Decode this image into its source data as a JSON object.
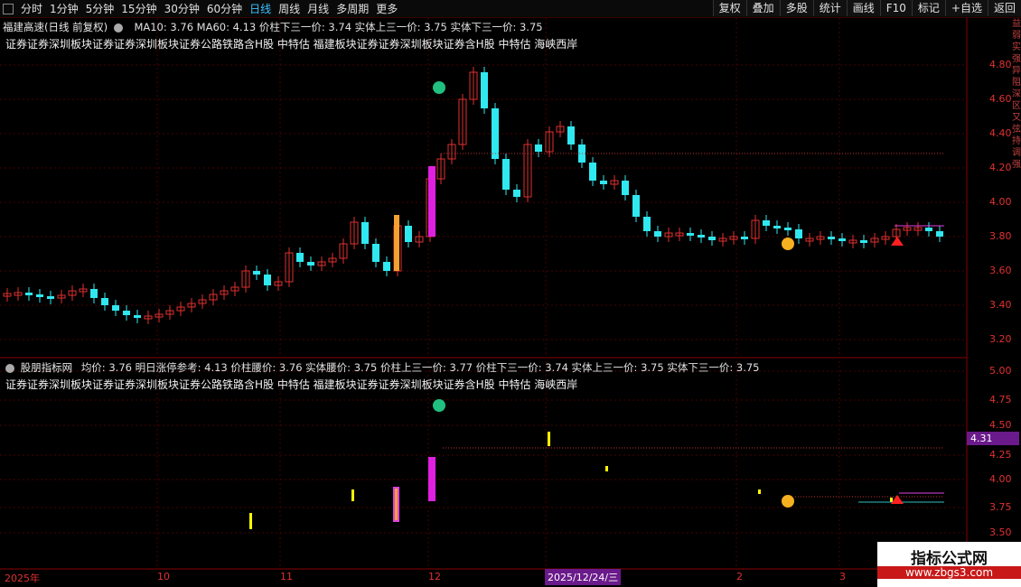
{
  "toolbar": {
    "left_items": [
      "分时",
      "1分钟",
      "5分钟",
      "15分钟",
      "30分钟",
      "60分钟",
      "日线",
      "周线",
      "月线",
      "多周期",
      "更多"
    ],
    "active_index": 6,
    "right_buttons": [
      "复权",
      "叠加",
      "多股",
      "统计",
      "画线",
      "F10",
      "标记",
      "+自选",
      "返回"
    ]
  },
  "main": {
    "title": "福建高速(日线 前复权)",
    "indicators": "MA10: 3.76  MA60: 4.13  价柱下三一价: 3.74  实体上三一价: 3.75  实体下三一价: 3.75",
    "sectors": "证券证券深圳板块证券证券深圳板块证券公路铁路含H股 中特估 福建板块证券证券深圳板块证券含H股 中特估 海峡西岸",
    "y_labels": [
      "4.80",
      "4.60",
      "4.40",
      "4.20",
      "4.00",
      "3.80",
      "3.60",
      "3.40",
      "3.20"
    ]
  },
  "sub": {
    "title": "股朋指标网",
    "indicators": "均价: 3.76  明日涨停参考: 4.13  价柱腰价: 3.76  实体腰价: 3.75  价柱上三一价: 3.77  价柱下三一价: 3.74  实体上三一价: 3.75  实体下三一价: 3.75",
    "sectors": "证券证券深圳板块证券证券深圳板块证券公路铁路含H股 中特估 福建板块证券证券深圳板块证券含H股 中特估 海峡西岸",
    "y_labels": [
      "5.00",
      "4.75",
      "4.50",
      "4.25",
      "4.00",
      "3.75",
      "3.50"
    ],
    "price_tag": "4.31"
  },
  "x_axis": {
    "labels": [
      "2025年",
      "10",
      "11",
      "12",
      "2",
      "3"
    ],
    "current_date": "2025/12/24/三"
  },
  "watermark": {
    "title": "指标公式网",
    "url": "www.zbgs3.com"
  },
  "right_strip": "益弱实强异阻深区又弦持调强",
  "colors": {
    "up": "#e03030",
    "down": "#30e8f0",
    "magenta": "#e020e0",
    "yellow": "#ffff00",
    "grid": "#5a0000"
  }
}
